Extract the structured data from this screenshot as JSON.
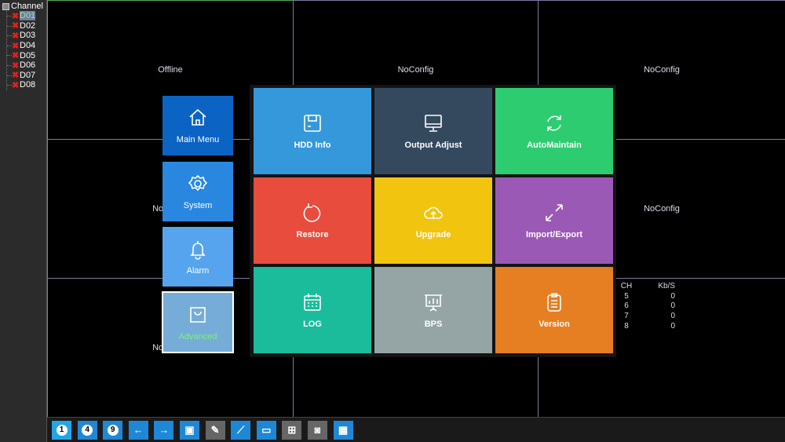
{
  "sidebar": {
    "title": "Channel",
    "channels": [
      "D01",
      "D02",
      "D03",
      "D04",
      "D05",
      "D06",
      "D07",
      "D08"
    ],
    "selected": "D01",
    "status_icon": "red-x-icon"
  },
  "cells": [
    "Offline",
    "NoConfig",
    "NoConfig",
    "NoConfig",
    "",
    "NoConfig",
    "NoConfig",
    "",
    ""
  ],
  "stats": {
    "headers": [
      "CH",
      "Kb/S"
    ],
    "rows": [
      [
        "5",
        "0"
      ],
      [
        "6",
        "0"
      ],
      [
        "7",
        "0"
      ],
      [
        "8",
        "0"
      ]
    ]
  },
  "left_menu": [
    {
      "label": "Main Menu",
      "icon": "home-icon",
      "color": "#0b63c4"
    },
    {
      "label": "System",
      "icon": "gear-icon",
      "color": "#2a87e0"
    },
    {
      "label": "Alarm",
      "icon": "bell-icon",
      "color": "#56a4ee"
    },
    {
      "label": "Advanced",
      "icon": "bag-icon",
      "color": "#76acd8",
      "selected": true
    }
  ],
  "tiles": [
    {
      "label": "HDD Info",
      "icon": "disk-icon",
      "color": "#3498db"
    },
    {
      "label": "Output Adjust",
      "icon": "monitor-icon",
      "color": "#34495e"
    },
    {
      "label": "AutoMaintain",
      "icon": "refresh-icon",
      "color": "#2ecc71"
    },
    {
      "label": "Restore",
      "icon": "restore-icon",
      "color": "#e74c3c"
    },
    {
      "label": "Upgrade",
      "icon": "cloud-upload-icon",
      "color": "#f1c40f"
    },
    {
      "label": "Import/Export",
      "icon": "expand-arrows-icon",
      "color": "#9b59b6"
    },
    {
      "label": "LOG",
      "icon": "calendar-icon",
      "color": "#1abc9c"
    },
    {
      "label": "BPS",
      "icon": "chart-board-icon",
      "color": "#95a5a6"
    },
    {
      "label": "Version",
      "icon": "clipboard-icon",
      "color": "#e67e22"
    }
  ],
  "toolbar": [
    "1",
    "4",
    "9",
    "arrow-left-icon",
    "arrow-right-icon",
    "fullscreen-icon",
    "ptz-camera-icon",
    "chart-icon",
    "monitor-icon",
    "network-icon",
    "hdd-icon",
    "qr-code-icon"
  ]
}
